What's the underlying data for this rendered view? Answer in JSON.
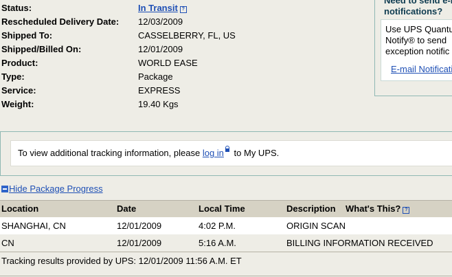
{
  "details": [
    {
      "label": "Status:",
      "value": "In Transit"
    },
    {
      "label": "Rescheduled Delivery Date:",
      "value": "12/03/2009"
    },
    {
      "label": "Shipped To:",
      "value": "CASSELBERRY, FL, US"
    },
    {
      "label": "Shipped/Billed On:",
      "value": "12/01/2009"
    },
    {
      "label": "Product:",
      "value": "WORLD EASE"
    },
    {
      "label": "Type:",
      "value": "Package"
    },
    {
      "label": "Service:",
      "value": "EXPRESS"
    },
    {
      "label": "Weight:",
      "value": "19.40 Kgs"
    }
  ],
  "help_glyph": "?",
  "notify": {
    "heading_line1": "Need to send e-m",
    "heading_line2": "notifications?",
    "body_line1": "Use UPS Quantu",
    "body_line2": "Notify® to send",
    "body_line3": "exception notific",
    "link": "E-mail Notificati"
  },
  "login": {
    "before": "To view additional tracking information, please",
    "link": "log in",
    "after": "to My UPS."
  },
  "progress_toggle": "Hide Package Progress",
  "table": {
    "headers": {
      "location": "Location",
      "date": "Date",
      "time": "Local Time",
      "description": "Description",
      "whats_this": "What's This?"
    },
    "rows": [
      {
        "location": "SHANGHAI, CN",
        "date": "12/01/2009",
        "time": "4:02 P.M.",
        "description": "ORIGIN SCAN"
      },
      {
        "location": "CN",
        "date": "12/01/2009",
        "time": "5:16 A.M.",
        "description": "BILLING INFORMATION RECEIVED"
      }
    ]
  },
  "footer": "Tracking results provided by UPS:  12/01/2009 11:56 A.M.  ET",
  "colors": {
    "link": "#1e4fb5",
    "background": "#eeede6",
    "header_row": "#d6d2c4",
    "box_border": "#8fb8b3"
  }
}
